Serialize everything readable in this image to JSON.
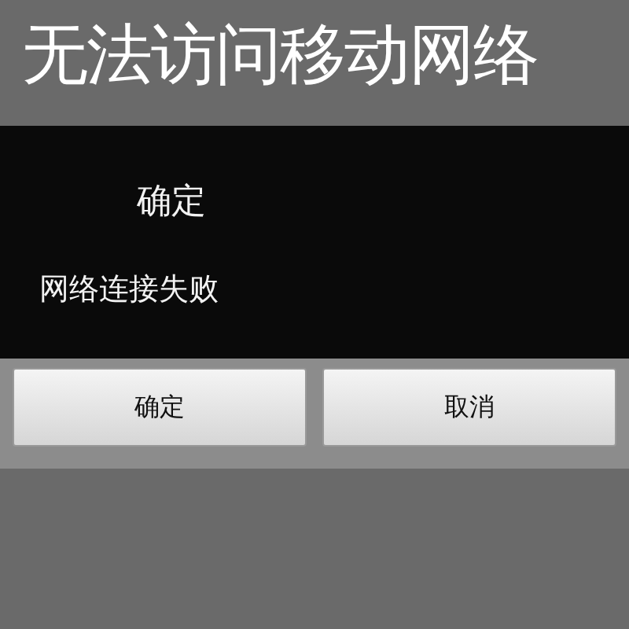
{
  "headline": "无法访问移动网络",
  "dialog": {
    "title": "确定",
    "message": "网络连接失败",
    "buttons": [
      {
        "label": "确定"
      },
      {
        "label": "取消"
      }
    ]
  }
}
